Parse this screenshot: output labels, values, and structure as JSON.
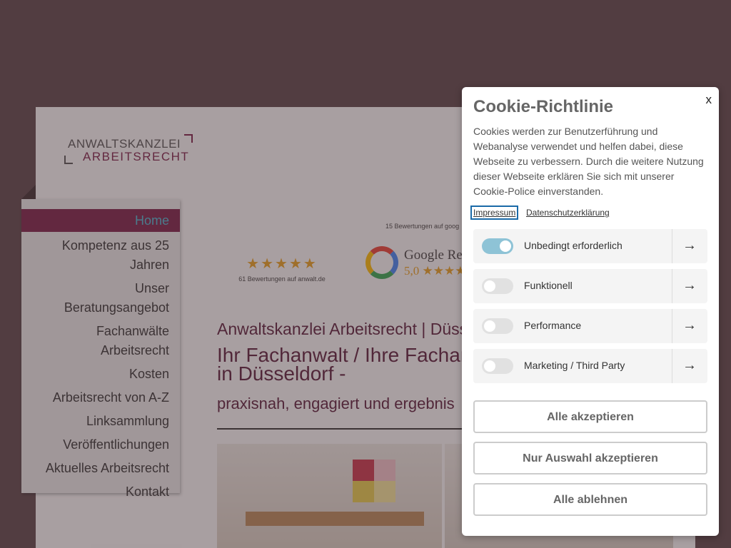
{
  "site": {
    "logo": {
      "line1": "ANWALTSKANZLEI",
      "line2": "ARBEITSRECHT"
    },
    "rating_anwalt": {
      "stars": "★★★★★",
      "caption": "61 Bewertungen auf anwalt.de"
    },
    "rating_google": {
      "caption": "15 Bewertungen auf goog",
      "title": "Google Re",
      "score": "5,0 ★★★★"
    },
    "heading_sub": "Anwaltskanzlei Arbeitsrecht | Düss",
    "heading_main": "Ihr Fachanwalt / Ihre Fachan\nin Düsseldorf -",
    "heading_tag": "praxisnah, engagiert und ergebnis",
    "menu": [
      "Home",
      "Kompetenz aus 25 Jahren",
      "Unser Beratungsangebot",
      "Fachanwälte Arbeitsrecht",
      "Kosten",
      "Arbeitsrecht von A-Z",
      "Linksammlung",
      "Veröffentlichungen",
      "Aktuelles Arbeitsrecht",
      "Kontakt"
    ]
  },
  "cookie": {
    "close": "x",
    "title": "Cookie-Richtlinie",
    "text": "Cookies werden zur Benutzerführung und Webanalyse verwendet und helfen dabei, diese Webseite zu verbessern. Durch die weitere Nutzung dieser Webseite erklären Sie sich mit unserer Cookie-Police einverstanden.",
    "link_impressum": "Impressum",
    "link_privacy": "Datenschutzerklärung",
    "categories": [
      {
        "label": "Unbedingt erforderlich",
        "enabled": true
      },
      {
        "label": "Funktionell",
        "enabled": false
      },
      {
        "label": "Performance",
        "enabled": false
      },
      {
        "label": "Marketing / Third Party",
        "enabled": false
      }
    ],
    "arrow": "→",
    "btn_accept_all": "Alle akzeptieren",
    "btn_accept_selection": "Nur Auswahl akzeptieren",
    "btn_reject_all": "Alle ablehnen",
    "colors": {
      "toggle_on": "#8ec3d6",
      "accent": "#7a1f47"
    }
  }
}
